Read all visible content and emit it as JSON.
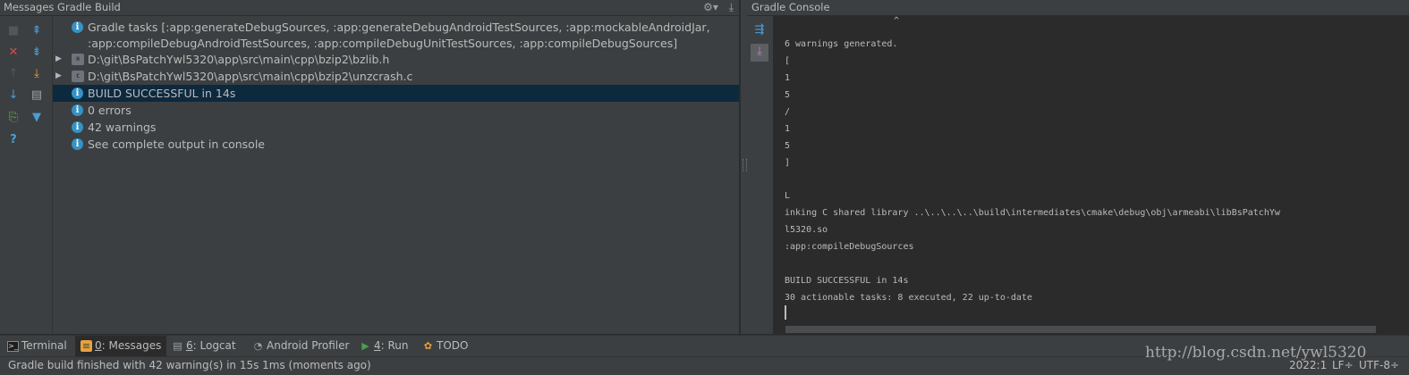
{
  "messages_panel": {
    "title": "Messages Gradle Build",
    "rows": [
      {
        "type": "info",
        "text": "Gradle tasks [:app:generateDebugSources, :app:generateDebugAndroidTestSources, :app:mockableAndroidJar,"
      },
      {
        "type": "cont",
        "text": ":app:compileDebugAndroidTestSources, :app:compileDebugUnitTestSources, :app:compileDebugSources]"
      },
      {
        "type": "file",
        "text": "D:\\git\\BsPatchYwl5320\\app\\src\\main\\cpp\\bzip2\\bzlib.h"
      },
      {
        "type": "file",
        "text": "D:\\git\\BsPatchYwl5320\\app\\src\\main\\cpp\\bzip2\\unzcrash.c"
      },
      {
        "type": "info",
        "text": "BUILD SUCCESSFUL in 14s"
      },
      {
        "type": "info",
        "text": "0 errors"
      },
      {
        "type": "info",
        "text": "42 warnings"
      },
      {
        "type": "info",
        "text": "See complete output in console"
      }
    ]
  },
  "console_panel": {
    "title": "Gradle Console",
    "lines": [
      "^",
      "6 warnings generated.",
      "[",
      "1",
      "5",
      "/",
      "1",
      "5",
      "]",
      "",
      "L",
      "inking C shared library ..\\..\\..\\..\\build\\intermediates\\cmake\\debug\\obj\\armeabi\\libBsPatchYw",
      "l5320.so",
      ":app:compileDebugSources",
      "",
      "BUILD SUCCESSFUL in 14s",
      "30 actionable tasks: 8 executed, 22 up-to-date"
    ]
  },
  "tool_tabs": {
    "terminal": "Terminal",
    "messages_num": "0",
    "messages": ": Messages",
    "logcat_num": "6",
    "logcat": ": Logcat",
    "profiler": "Android Profiler",
    "run_num": "4",
    "run": ": Run",
    "todo": "TODO"
  },
  "status_bar": {
    "message": "Gradle build finished with 42 warning(s) in 15s 1ms (moments ago)",
    "position": "2022:1",
    "line_sep": "LF÷",
    "encoding": "UTF-8÷"
  },
  "watermark": "http://blog.csdn.net/ywl5320",
  "icons": [
    "settings-icon",
    "pin-icon",
    "stop-icon",
    "close-icon",
    "expand-all-icon",
    "collapse-all-icon",
    "export-icon",
    "next-icon",
    "prev-icon",
    "filter-icon",
    "help-icon",
    "info-icon",
    "file-icon",
    "wrap-icon",
    "scroll-end-icon",
    "terminal-icon",
    "messages-icon",
    "logcat-icon",
    "profiler-icon",
    "run-icon",
    "todo-icon"
  ]
}
